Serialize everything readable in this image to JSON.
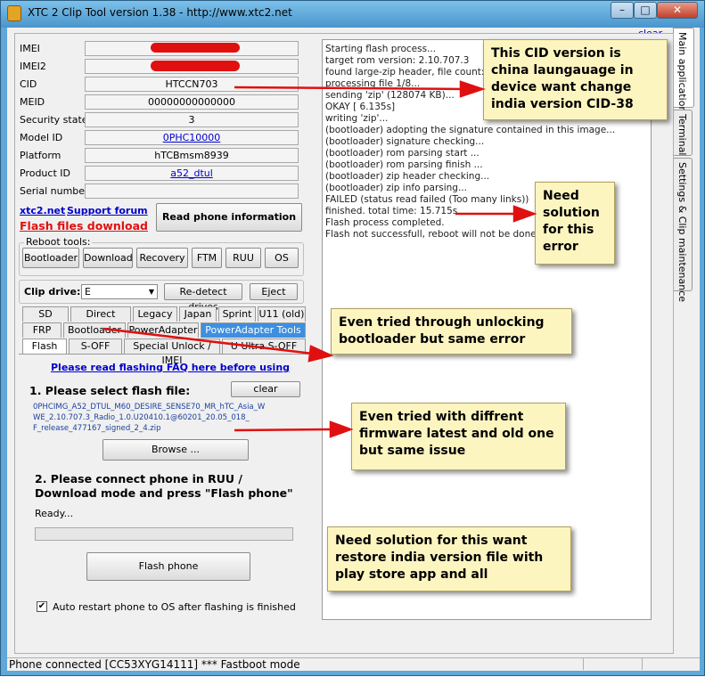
{
  "window": {
    "title": "XTC 2 Clip Tool version 1.38 - http://www.xtc2.net",
    "minimize": "–",
    "maximize": "□",
    "close": "✕"
  },
  "tabs_right": {
    "main": "Main application",
    "terminal": "Terminal",
    "settings": "Settings & Clip maintenance"
  },
  "log_clear": "clear",
  "info": {
    "imei_label": "IMEI",
    "imei_value": "",
    "imei2_label": "IMEI2",
    "imei2_value": "",
    "cid_label": "CID",
    "cid_value": "HTCCN703",
    "meid_label": "MEID",
    "meid_value": "00000000000000",
    "security_label": "Security state",
    "security_value": "3",
    "model_label": "Model ID",
    "model_value": "0PHC10000",
    "platform_label": "Platform",
    "platform_value": "hTCBmsm8939",
    "product_label": "Product ID",
    "product_value": "a52_dtul",
    "serial_label": "Serial number",
    "serial_value": ""
  },
  "links": {
    "site": "xtc2.net",
    "forum": "Support forum",
    "flash_files": "Flash files download"
  },
  "read_button": "Read phone information",
  "reboot": {
    "title": "Reboot tools:",
    "buttons": [
      "Bootloader",
      "Download",
      "Recovery",
      "FTM",
      "RUU",
      "OS"
    ]
  },
  "clip": {
    "label": "Clip drive:",
    "value": "E",
    "redetect": "Re-detect drives",
    "eject": "Eject"
  },
  "tab_rows": {
    "row1": [
      "SD mode",
      "Direct mode",
      "Legacy",
      "Japan",
      "Sprint",
      "U11 (old)"
    ],
    "row2": [
      "FRP",
      "Bootloader",
      "PowerAdapter",
      "PowerAdapter Tools"
    ],
    "row3": [
      "Flash",
      "S-OFF",
      "Special Unlock / IMEI",
      "U Ultra S-OFF"
    ]
  },
  "flash": {
    "faq": "Please read flashing FAQ here before using",
    "step1": "1. Please select flash file:",
    "clear": "clear",
    "file_line1": "0PHCIMG_A52_DTUL_M60_DESIRE_SENSE70_MR_hTC_Asia_W",
    "file_line2": "WE_2.10.707.3_Radio_1.0.U20410.1@60201_20.05_018_",
    "file_line3": "F_release_477167_signed_2_4.zip",
    "browse": "Browse ...",
    "step2": "2. Please connect phone in RUU / Download mode and press \"Flash phone\"",
    "ready": "Ready...",
    "progress": 0,
    "flash_button": "Flash phone",
    "auto_restart": "Auto restart phone to OS after flashing is finished",
    "check": "✔"
  },
  "log_lines": [
    "Starting flash process...",
    "target rom version: 2.10.707.3",
    "found large-zip header, file count: 8",
    "processing file 1/8...",
    "sending 'zip' (128074 KB)...",
    "OKAY [  6.135s]",
    "writing 'zip'...",
    "(bootloader) adopting the signature contained in this image...",
    "(bootloader) signature checking...",
    "(bootloader) rom parsing start ...",
    "(bootloader) rom parsing finish ...",
    "(bootloader) zip header checking...",
    "(bootloader) zip info parsing...",
    "FAILED (status read failed (Too many links))",
    "finished. total time: 15.715s",
    "Flash process completed.",
    "Flash not successfull, reboot will not be done"
  ],
  "annotations": {
    "a1": "This CID version is china laungauage in device want change india version CID-38",
    "a2": "Need solution for this error",
    "a3": "Even tried through unlocking bootloader but same error",
    "a4": "Even tried with diffrent firmware latest and old one but same issue",
    "a5": "Need solution for this want restore india version file with play store app and all"
  },
  "status": "Phone connected [CC53XYG14111] *** Fastboot mode"
}
